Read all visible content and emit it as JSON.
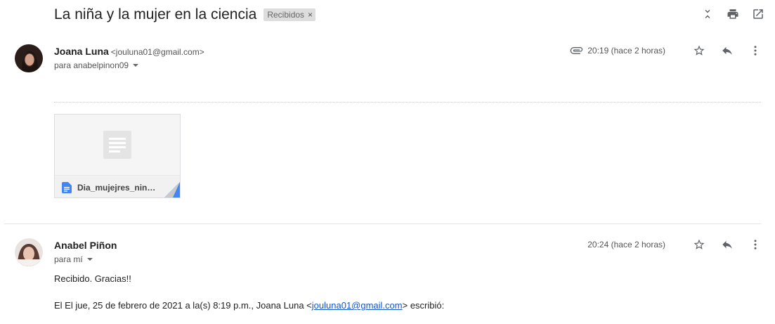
{
  "subject": "La niña y la mujer en la ciencia",
  "label_chip": {
    "text": "Recibidos",
    "remove": "×"
  },
  "top_actions": [
    "collapse-all-icon",
    "print-icon",
    "open-new-window-icon"
  ],
  "messages": [
    {
      "sender_name": "Joana Luna",
      "sender_email": "<jouluna01@gmail.com>",
      "to": "para anabelpinon09",
      "time": "20:19 (hace 2 horas)",
      "has_attachment_icon": true,
      "attachment": {
        "name": "Dia_mujejres_ninas...",
        "icon": "google-doc-icon"
      }
    },
    {
      "sender_name": "Anabel Piñon",
      "to": "para mí",
      "time": "20:24 (hace 2 horas)",
      "body_line1": "Recibido. Gracias!!",
      "quote_prefix": "El El jue, 25 de febrero de 2021 a la(s) 8:19 p.m., Joana Luna <",
      "quote_email": "jouluna01@gmail.com",
      "quote_suffix": "> escribió:"
    }
  ],
  "colors": {
    "link": "#1155cc",
    "doc_blue": "#4285f4",
    "icon_gray": "#5f6368"
  }
}
